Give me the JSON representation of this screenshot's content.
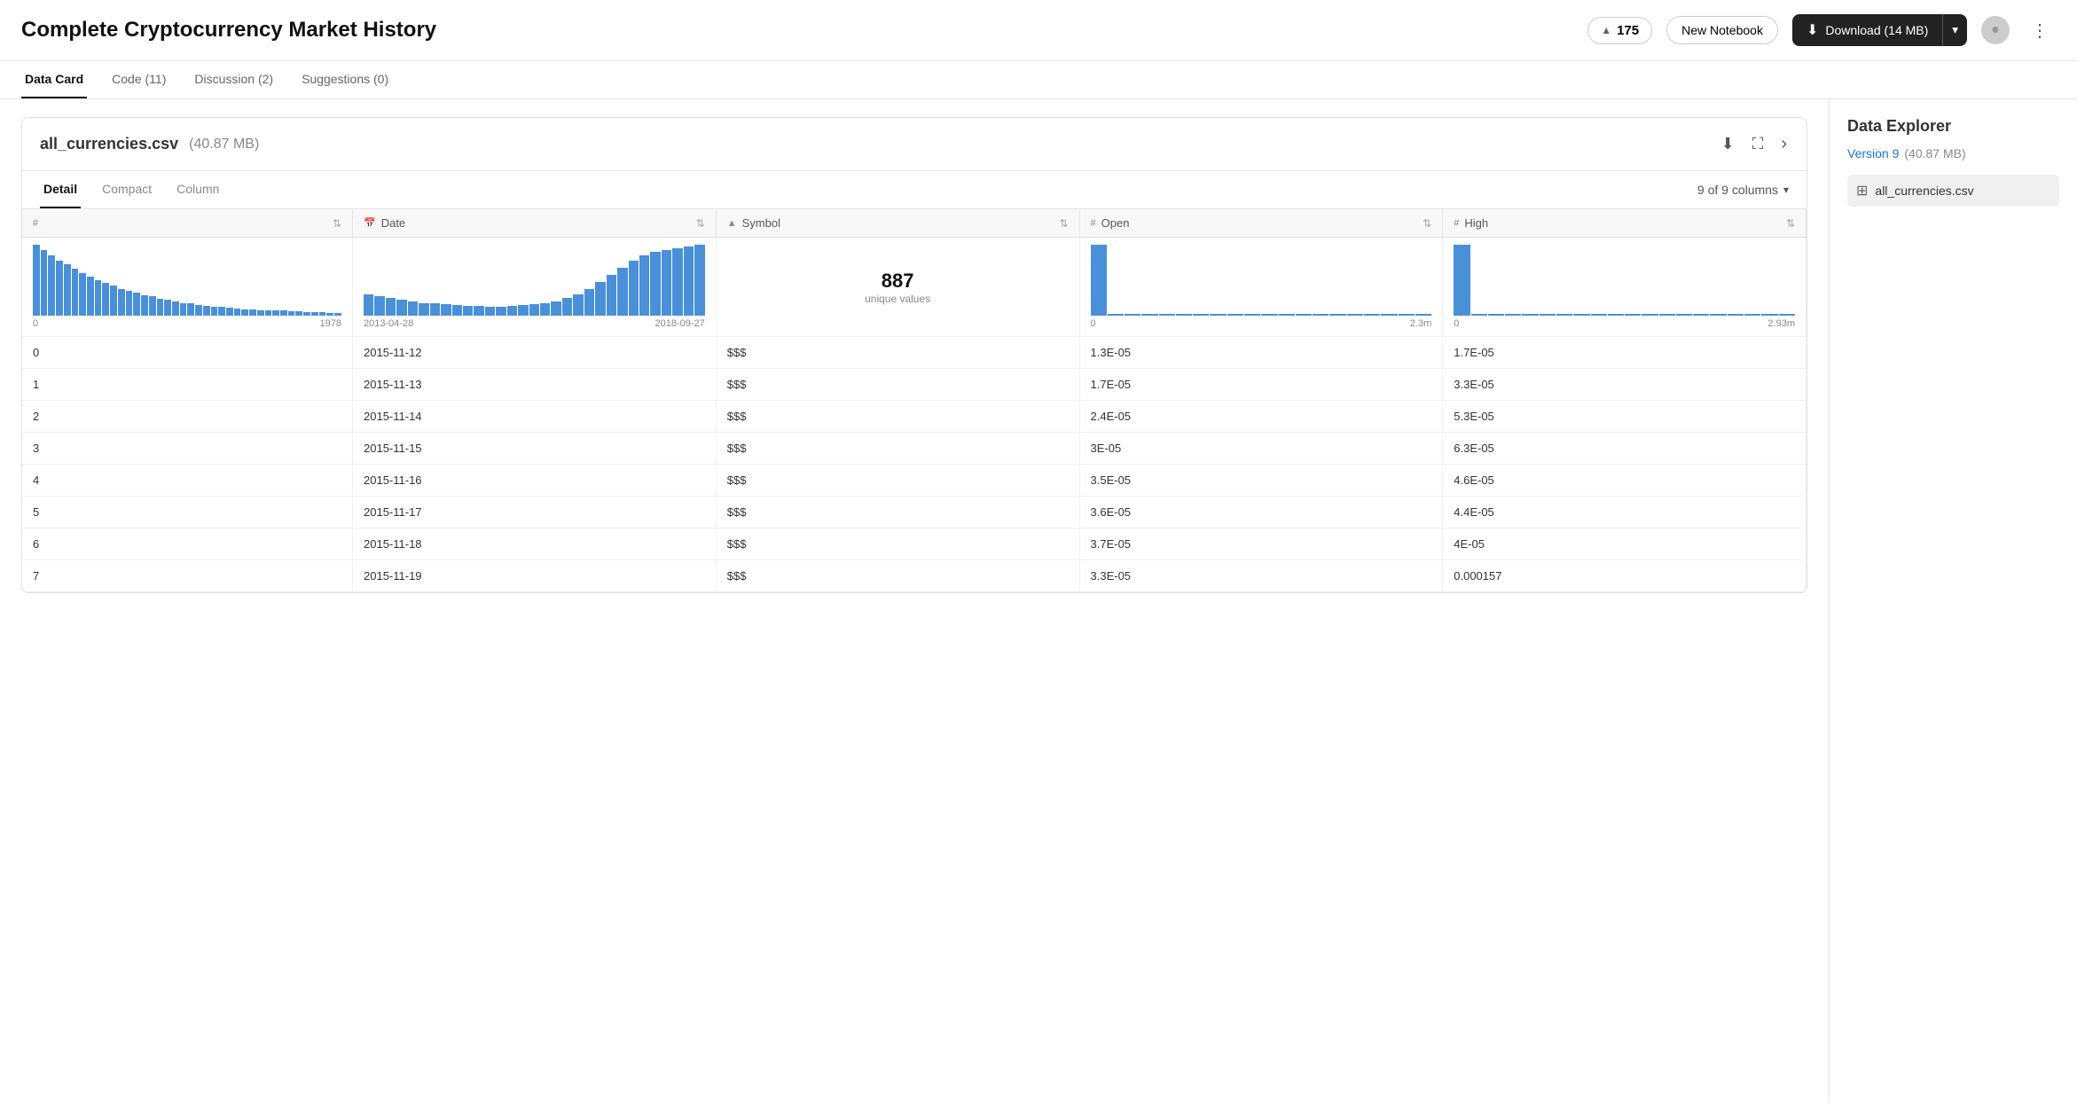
{
  "header": {
    "title": "Complete Cryptocurrency Market History",
    "vote_count": "175",
    "vote_arrow": "▲",
    "new_notebook_label": "New Notebook",
    "download_label": "Download (14 MB)"
  },
  "tabs": [
    {
      "id": "data-card",
      "label": "Data Card",
      "active": true
    },
    {
      "id": "code",
      "label": "Code (11)",
      "active": false
    },
    {
      "id": "discussion",
      "label": "Discussion (2)",
      "active": false
    },
    {
      "id": "suggestions",
      "label": "Suggestions (0)",
      "active": false
    }
  ],
  "file_card": {
    "filename": "all_currencies.csv",
    "filesize": "(40.87 MB)",
    "sub_tabs": [
      {
        "id": "detail",
        "label": "Detail",
        "active": true
      },
      {
        "id": "compact",
        "label": "Compact",
        "active": false
      },
      {
        "id": "column",
        "label": "Column",
        "active": false
      }
    ],
    "columns_selector": "9 of 9 columns"
  },
  "table": {
    "columns": [
      {
        "id": "index",
        "label": "#",
        "type": "#",
        "sortable": true
      },
      {
        "id": "date",
        "label": "Date",
        "type": "cal",
        "sortable": true
      },
      {
        "id": "symbol",
        "label": "Symbol",
        "type": "tri",
        "sortable": true
      },
      {
        "id": "open",
        "label": "Open",
        "type": "#",
        "sortable": true
      },
      {
        "id": "high",
        "label": "High",
        "type": "#",
        "sortable": true
      }
    ],
    "histogram_row": {
      "index": {
        "type": "histogram",
        "min": "0",
        "max": "1978"
      },
      "date": {
        "type": "histogram",
        "min": "2013-04-28",
        "max": "2018-09-27"
      },
      "symbol": {
        "type": "unique",
        "count": "887",
        "label": "unique values"
      },
      "open": {
        "type": "spindle",
        "min": "0",
        "max": "2.3m"
      },
      "high": {
        "type": "spindle",
        "min": "0",
        "max": "2.93m"
      }
    },
    "rows": [
      {
        "index": "0",
        "date": "2015-11-12",
        "symbol": "$$$",
        "open": "1.3E-05",
        "high": "1.7E-05"
      },
      {
        "index": "1",
        "date": "2015-11-13",
        "symbol": "$$$",
        "open": "1.7E-05",
        "high": "3.3E-05"
      },
      {
        "index": "2",
        "date": "2015-11-14",
        "symbol": "$$$",
        "open": "2.4E-05",
        "high": "5.3E-05"
      },
      {
        "index": "3",
        "date": "2015-11-15",
        "symbol": "$$$",
        "open": "3E-05",
        "high": "6.3E-05"
      },
      {
        "index": "4",
        "date": "2015-11-16",
        "symbol": "$$$",
        "open": "3.5E-05",
        "high": "4.6E-05"
      },
      {
        "index": "5",
        "date": "2015-11-17",
        "symbol": "$$$",
        "open": "3.6E-05",
        "high": "4.4E-05"
      },
      {
        "index": "6",
        "date": "2015-11-18",
        "symbol": "$$$",
        "open": "3.7E-05",
        "high": "4E-05"
      },
      {
        "index": "7",
        "date": "2015-11-19",
        "symbol": "$$$",
        "open": "3.3E-05",
        "high": "0.000157"
      }
    ]
  },
  "sidebar": {
    "title": "Data Explorer",
    "version_label": "Version 9",
    "version_size": "(40.87 MB)",
    "file_item": "all_currencies.csv"
  }
}
